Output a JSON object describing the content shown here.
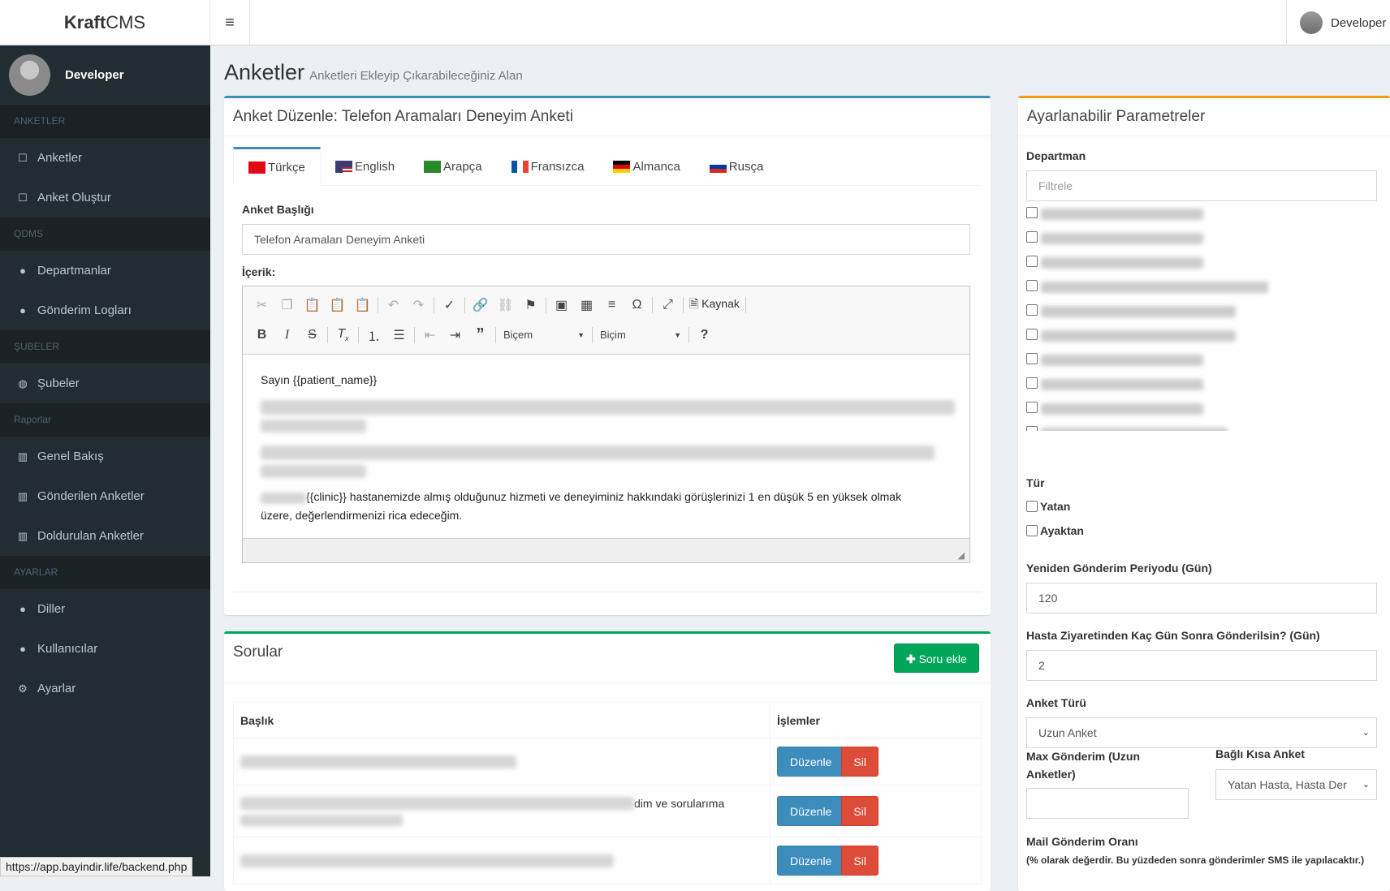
{
  "header": {
    "logo_bold": "Kraft",
    "logo_rest": "CMS",
    "menu_icon": "hamburger-icon",
    "user": "Developer"
  },
  "sidebar": {
    "user": "Developer",
    "sections": [
      {
        "title": "ANKETLER",
        "items": [
          {
            "label": "Anketler",
            "icon": "square-icon"
          },
          {
            "label": "Anket Oluştur",
            "icon": "square-icon"
          }
        ]
      },
      {
        "title": "QDMS",
        "items": [
          {
            "label": "Departmanlar",
            "icon": "user-icon"
          },
          {
            "label": "Gönderim Logları",
            "icon": "user-icon"
          }
        ]
      },
      {
        "title": "ŞUBELER",
        "items": [
          {
            "label": "Şubeler",
            "icon": "globe-icon"
          }
        ]
      },
      {
        "title": "Raporlar",
        "items": [
          {
            "label": "Genel Bakış",
            "icon": "bar-chart-icon"
          },
          {
            "label": "Gönderilen Anketler",
            "icon": "bar-chart-icon"
          },
          {
            "label": "Doldurulan Anketler",
            "icon": "bar-chart-icon"
          }
        ]
      },
      {
        "title": "AYARLAR",
        "items": [
          {
            "label": "Diller",
            "icon": "user-icon"
          },
          {
            "label": "Kullanıcılar",
            "icon": "user-icon"
          },
          {
            "label": "Ayarlar",
            "icon": "gear-icon"
          }
        ]
      }
    ]
  },
  "page": {
    "title": "Anketler",
    "subtitle": "Anketleri Ekleyip Çıkarabileceğiniz Alan"
  },
  "edit": {
    "title": "Anket Düzenle: Telefon Aramaları Deneyim Anketi",
    "tabs": [
      "Türkçe",
      "English",
      "Arapça",
      "Fransızca",
      "Almanca",
      "Rusça"
    ],
    "title_label": "Anket Başlığı",
    "title_value": "Telefon Aramaları Deneyim Anketi",
    "content_label": "İçerik:",
    "toolbar": {
      "source": "Kaynak",
      "format1": "Biçem",
      "format2": "Biçim",
      "help": "?"
    },
    "content_greeting": "Sayın {{patient_name}}",
    "content_line1": "{{clinic}} hastanemizde almış olduğunuz hizmeti ve deneyiminiz hakkındaki görüşlerinizi 1 en düşük 5 en yüksek olmak",
    "content_line2": "üzere, değerlendirmenizi rica edeceğim."
  },
  "questions": {
    "title": "Sorular",
    "add_button": "Soru ekle",
    "col_title": "Başlık",
    "col_actions": "İşlemler",
    "edit_label": "Düzenle",
    "delete_label": "Sil",
    "row2_visible": "dim ve sorularıma"
  },
  "params": {
    "title": "Ayarlanabilir Parametreler",
    "dept_label": "Departman",
    "dept_placeholder": "Filtrele",
    "type_label": "Tür",
    "type_opts": [
      "Yatan",
      "Ayaktan"
    ],
    "resend_label": "Yeniden Gönderim Periyodu (Gün)",
    "resend_value": "120",
    "days_after_label": "Hasta Ziyaretinden Kaç Gün Sonra Gönderilsin? (Gün)",
    "days_after_value": "2",
    "survey_type_label": "Anket Türü",
    "survey_type_value": "Uzun Anket",
    "max_send_label_1": "Max Gönderim (Uzun",
    "max_send_label_2": "Anketler)",
    "max_send_value": "",
    "linked_label": "Bağlı Kısa Anket",
    "linked_value": "Yatan Hasta, Hasta Der",
    "mail_label": "Mail Gönderim Oranı",
    "mail_note": "(% olarak değerdir. Bu yüzdeden sonra gönderimler SMS ile yapılacaktır.)"
  },
  "status_url": "https://app.bayindir.life/backend.php",
  "colors": {
    "sidebar": "#222d32",
    "primary": "#3c8dbc",
    "success": "#00a65a",
    "danger": "#dd4b39",
    "warning": "#f39c12"
  }
}
